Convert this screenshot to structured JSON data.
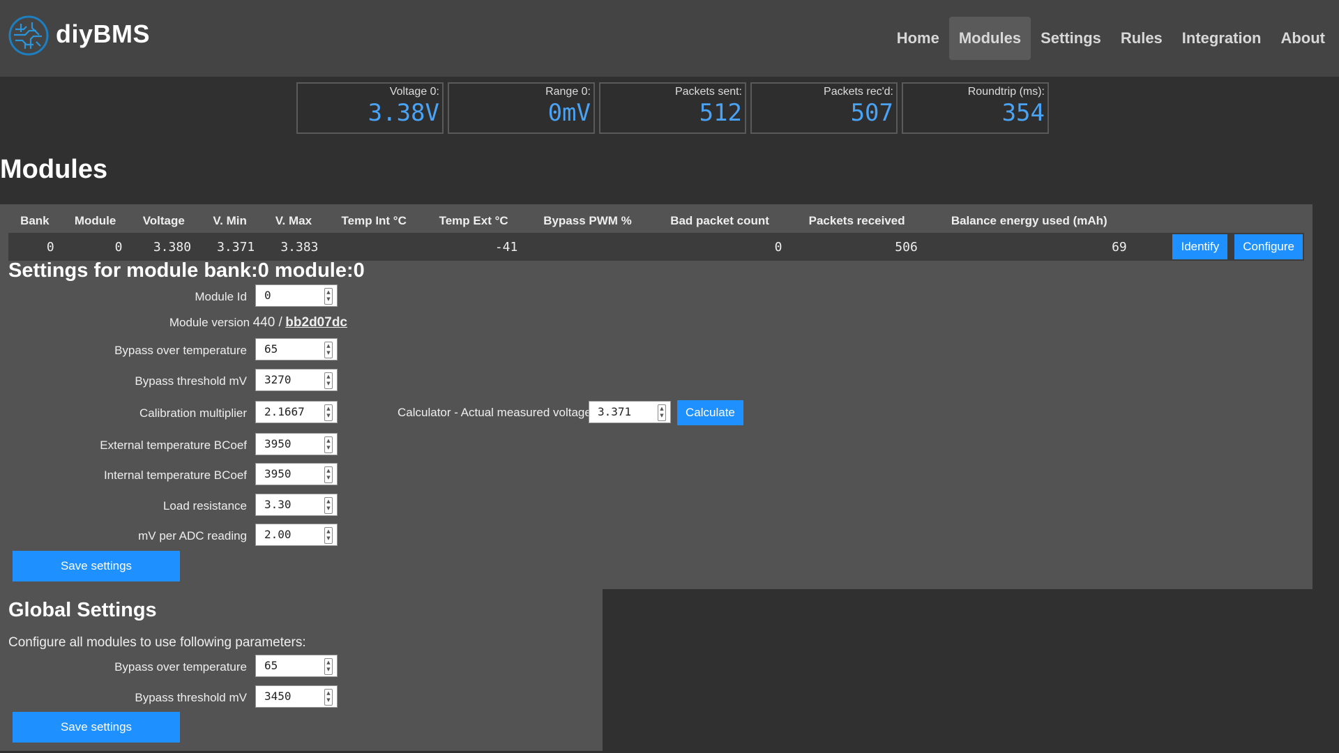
{
  "header": {
    "brand": "diyBMS",
    "nav": [
      "Home",
      "Modules",
      "Settings",
      "Rules",
      "Integration",
      "About"
    ],
    "active_nav": "Modules"
  },
  "stats": [
    {
      "label": "Voltage 0:",
      "value": "3.38V"
    },
    {
      "label": "Range 0:",
      "value": "0mV"
    },
    {
      "label": "Packets sent:",
      "value": "512"
    },
    {
      "label": "Packets rec'd:",
      "value": "507"
    },
    {
      "label": "Roundtrip (ms):",
      "value": "354"
    }
  ],
  "page_title": "Modules",
  "table": {
    "headers": [
      "Bank",
      "Module",
      "Voltage",
      "V. Min",
      "V. Max",
      "Temp Int °C",
      "Temp Ext °C",
      "Bypass PWM %",
      "Bad packet count",
      "Packets received",
      "Balance energy used (mAh)"
    ],
    "row": {
      "bank": "0",
      "module": "0",
      "voltage": "3.380",
      "vmin": "3.371",
      "vmax": "3.383",
      "temp_int": "",
      "temp_ext": "-41",
      "bypass_pwm": "",
      "bad_packets": "0",
      "packets_received": "506",
      "balance_energy": "69"
    },
    "identify_label": "Identify",
    "configure_label": "Configure"
  },
  "module_settings": {
    "title": "Settings for module bank:0 module:0",
    "module_id_label": "Module Id",
    "module_id": "0",
    "version_label": "Module version",
    "version_value": "440 /",
    "version_hash": "bb2d07dc",
    "bypass_temp_label": "Bypass over temperature",
    "bypass_temp": "65",
    "bypass_threshold_label": "Bypass threshold mV",
    "bypass_threshold": "3270",
    "calibration_label": "Calibration multiplier",
    "calibration": "2.1667",
    "calculator_label": "Calculator - Actual measured voltage",
    "calculator_value": "3.371",
    "calculate_label": "Calculate",
    "ext_bcoef_label": "External temperature BCoef",
    "ext_bcoef": "3950",
    "int_bcoef_label": "Internal temperature BCoef",
    "int_bcoef": "3950",
    "load_resistance_label": "Load resistance",
    "load_resistance": "3.30",
    "mv_per_adc_label": "mV per ADC reading",
    "mv_per_adc": "2.00",
    "save_label": "Save settings"
  },
  "global_settings": {
    "title": "Global Settings",
    "description": "Configure all modules to use following parameters:",
    "bypass_temp_label": "Bypass over temperature",
    "bypass_temp": "65",
    "bypass_threshold_label": "Bypass threshold mV",
    "bypass_threshold": "3450",
    "save_label": "Save settings"
  },
  "colors": {
    "accent": "#1e90ff",
    "stat_value": "#4aa3f5",
    "header_bg": "#444444",
    "panel_bg": "#535353",
    "page_bg": "#303030"
  }
}
